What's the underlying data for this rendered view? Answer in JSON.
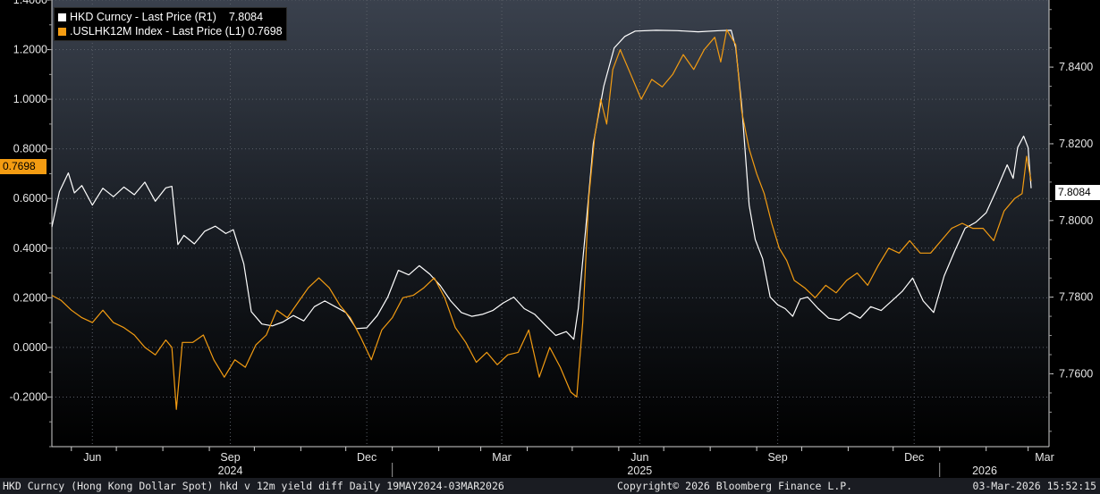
{
  "footer": {
    "left": "HKD Curncy (Hong Kong Dollar Spot) hkd v 12m yield diff Daily 19MAY2024-03MAR2026",
    "center": "Copyright© 2026 Bloomberg Finance L.P.",
    "right": "03-Mar-2026 15:52:15"
  },
  "legend": [
    {
      "label": "HKD Curncy - Last Price (R1)    ",
      "value": "7.8084",
      "color": "#ffffff"
    },
    {
      "label": ".USLHK12M Index - Last Price (L1) ",
      "value": "0.7698",
      "color": "#f39c12"
    }
  ],
  "tags": {
    "left_last": "0.7698",
    "right_last": "7.8084"
  },
  "chart_data": {
    "type": "line",
    "left_axis": {
      "ylim": [
        -0.4,
        1.4
      ],
      "ticks": [
        "1.4000",
        "1.2000",
        "1.0000",
        "0.8000",
        "0.6000",
        "0.4000",
        "0.2000",
        "0.0000",
        "-0.2000"
      ],
      "tick_values": [
        1.4,
        1.2,
        1.0,
        0.8,
        0.6,
        0.4,
        0.2,
        0.0,
        -0.2
      ]
    },
    "right_axis": {
      "ylim": [
        7.741,
        7.8575
      ],
      "ticks": [
        "7.8400",
        "7.8200",
        "7.8000",
        "7.7800",
        "7.7600"
      ],
      "tick_values": [
        7.84,
        7.82,
        7.8,
        7.78,
        7.76
      ]
    },
    "x_axis": {
      "month_labels": [
        "Jun",
        "Sep",
        "Dec",
        "Mar",
        "Jun",
        "Sep",
        "Dec",
        "Mar"
      ],
      "month_label_dates": [
        "2024-06-15",
        "2024-09-15",
        "2024-12-15",
        "2025-03-15",
        "2025-06-15",
        "2025-09-15",
        "2025-12-15",
        "2026-03-15"
      ],
      "year_labels": [
        "2024",
        "2025",
        "2026"
      ],
      "year_label_dates": [
        "2024-09-15",
        "2025-06-15",
        "2026-01-31"
      ],
      "year_separators": [
        "2025-01-01",
        "2026-01-01"
      ],
      "start": "2024-05-19",
      "end": "2026-03-03"
    },
    "grid": true,
    "series": [
      {
        "name": "HKD Curncy - Last Price (R1)",
        "axis": "right",
        "color": "#ffffff",
        "points": [
          [
            "2024-05-19",
            7.7983
          ],
          [
            "2024-05-24",
            7.8075
          ],
          [
            "2024-05-30",
            7.8124
          ],
          [
            "2024-06-03",
            7.8072
          ],
          [
            "2024-06-08",
            7.8091
          ],
          [
            "2024-06-15",
            7.804
          ],
          [
            "2024-06-22",
            7.8084
          ],
          [
            "2024-06-29",
            7.8062
          ],
          [
            "2024-07-06",
            7.8087
          ],
          [
            "2024-07-13",
            7.8067
          ],
          [
            "2024-07-20",
            7.81
          ],
          [
            "2024-07-27",
            7.805
          ],
          [
            "2024-08-03",
            7.8085
          ],
          [
            "2024-08-07",
            7.8089
          ],
          [
            "2024-08-11",
            7.7937
          ],
          [
            "2024-08-15",
            7.7961
          ],
          [
            "2024-08-22",
            7.7939
          ],
          [
            "2024-08-29",
            7.7972
          ],
          [
            "2024-09-05",
            7.7985
          ],
          [
            "2024-09-12",
            7.7966
          ],
          [
            "2024-09-17",
            7.7976
          ],
          [
            "2024-09-24",
            7.7887
          ],
          [
            "2024-09-29",
            7.7762
          ],
          [
            "2024-10-06",
            7.773
          ],
          [
            "2024-10-13",
            7.7725
          ],
          [
            "2024-10-20",
            7.7735
          ],
          [
            "2024-10-27",
            7.7752
          ],
          [
            "2024-11-03",
            7.7738
          ],
          [
            "2024-11-10",
            7.7775
          ],
          [
            "2024-11-17",
            7.779
          ],
          [
            "2024-11-24",
            7.7775
          ],
          [
            "2024-12-01",
            7.776
          ],
          [
            "2024-12-08",
            7.7718
          ],
          [
            "2024-12-15",
            7.772
          ],
          [
            "2024-12-22",
            7.7752
          ],
          [
            "2024-12-29",
            7.78
          ],
          [
            "2025-01-05",
            7.787
          ],
          [
            "2025-01-12",
            7.7858
          ],
          [
            "2025-01-19",
            7.7882
          ],
          [
            "2025-01-26",
            7.786
          ],
          [
            "2025-02-02",
            7.783
          ],
          [
            "2025-02-09",
            7.779
          ],
          [
            "2025-02-16",
            7.776
          ],
          [
            "2025-02-23",
            7.775
          ],
          [
            "2025-03-02",
            7.7755
          ],
          [
            "2025-03-09",
            7.7765
          ],
          [
            "2025-03-16",
            7.7785
          ],
          [
            "2025-03-23",
            7.78
          ],
          [
            "2025-03-30",
            7.777
          ],
          [
            "2025-04-06",
            7.7755
          ],
          [
            "2025-04-13",
            7.7727
          ],
          [
            "2025-04-20",
            7.77
          ],
          [
            "2025-04-27",
            7.771
          ],
          [
            "2025-05-02",
            7.769
          ],
          [
            "2025-05-05",
            7.777
          ],
          [
            "2025-05-10",
            7.798
          ],
          [
            "2025-05-15",
            7.82
          ],
          [
            "2025-05-22",
            7.835
          ],
          [
            "2025-05-29",
            7.845
          ],
          [
            "2025-06-05",
            7.848
          ],
          [
            "2025-06-12",
            7.8494
          ],
          [
            "2025-06-26",
            7.8496
          ],
          [
            "2025-07-10",
            7.8495
          ],
          [
            "2025-07-24",
            7.8492
          ],
          [
            "2025-08-07",
            7.8495
          ],
          [
            "2025-08-15",
            7.8496
          ],
          [
            "2025-08-18",
            7.845
          ],
          [
            "2025-08-22",
            7.83
          ],
          [
            "2025-08-27",
            7.804
          ],
          [
            "2025-08-31",
            7.795
          ],
          [
            "2025-09-05",
            7.79
          ],
          [
            "2025-09-10",
            7.78
          ],
          [
            "2025-09-15",
            7.778
          ],
          [
            "2025-09-20",
            7.777
          ],
          [
            "2025-09-25",
            7.775
          ],
          [
            "2025-09-30",
            7.7795
          ],
          [
            "2025-10-05",
            7.78
          ],
          [
            "2025-10-12",
            7.777
          ],
          [
            "2025-10-19",
            7.7745
          ],
          [
            "2025-10-26",
            7.774
          ],
          [
            "2025-11-02",
            7.776
          ],
          [
            "2025-11-09",
            7.7745
          ],
          [
            "2025-11-16",
            7.7775
          ],
          [
            "2025-11-23",
            7.7765
          ],
          [
            "2025-11-30",
            7.779
          ],
          [
            "2025-12-07",
            7.7815
          ],
          [
            "2025-12-14",
            7.785
          ],
          [
            "2025-12-21",
            7.779
          ],
          [
            "2025-12-28",
            7.776
          ],
          [
            "2026-01-04",
            7.7855
          ],
          [
            "2026-01-11",
            7.792
          ],
          [
            "2026-01-18",
            7.798
          ],
          [
            "2026-01-25",
            7.7995
          ],
          [
            "2026-02-01",
            7.802
          ],
          [
            "2026-02-08",
            7.808
          ],
          [
            "2026-02-15",
            7.8145
          ],
          [
            "2026-02-19",
            7.811
          ],
          [
            "2026-02-22",
            7.819
          ],
          [
            "2026-02-26",
            7.822
          ],
          [
            "2026-03-01",
            7.819
          ],
          [
            "2026-03-03",
            7.8084
          ]
        ]
      },
      {
        "name": ".USLHK12M Index - Last Price (L1)",
        "axis": "left",
        "color": "#f39c12",
        "points": [
          [
            "2024-05-19",
            0.21
          ],
          [
            "2024-05-25",
            0.19
          ],
          [
            "2024-06-01",
            0.15
          ],
          [
            "2024-06-08",
            0.12
          ],
          [
            "2024-06-15",
            0.1
          ],
          [
            "2024-06-22",
            0.15
          ],
          [
            "2024-06-29",
            0.1
          ],
          [
            "2024-07-06",
            0.08
          ],
          [
            "2024-07-13",
            0.05
          ],
          [
            "2024-07-20",
            0.0
          ],
          [
            "2024-07-27",
            -0.03
          ],
          [
            "2024-08-03",
            0.03
          ],
          [
            "2024-08-07",
            0.0
          ],
          [
            "2024-08-10",
            -0.25
          ],
          [
            "2024-08-14",
            0.02
          ],
          [
            "2024-08-21",
            0.02
          ],
          [
            "2024-08-28",
            0.05
          ],
          [
            "2024-09-04",
            -0.05
          ],
          [
            "2024-09-11",
            -0.12
          ],
          [
            "2024-09-18",
            -0.05
          ],
          [
            "2024-09-25",
            -0.08
          ],
          [
            "2024-10-02",
            0.01
          ],
          [
            "2024-10-09",
            0.05
          ],
          [
            "2024-10-16",
            0.15
          ],
          [
            "2024-10-23",
            0.12
          ],
          [
            "2024-10-30",
            0.18
          ],
          [
            "2024-11-06",
            0.24
          ],
          [
            "2024-11-13",
            0.28
          ],
          [
            "2024-11-20",
            0.24
          ],
          [
            "2024-11-27",
            0.17
          ],
          [
            "2024-12-04",
            0.12
          ],
          [
            "2024-12-11",
            0.04
          ],
          [
            "2024-12-18",
            -0.05
          ],
          [
            "2024-12-25",
            0.07
          ],
          [
            "2025-01-01",
            0.12
          ],
          [
            "2025-01-08",
            0.2
          ],
          [
            "2025-01-15",
            0.21
          ],
          [
            "2025-01-22",
            0.24
          ],
          [
            "2025-01-29",
            0.28
          ],
          [
            "2025-02-05",
            0.2
          ],
          [
            "2025-02-12",
            0.08
          ],
          [
            "2025-02-19",
            0.02
          ],
          [
            "2025-02-26",
            -0.06
          ],
          [
            "2025-03-05",
            -0.02
          ],
          [
            "2025-03-12",
            -0.07
          ],
          [
            "2025-03-19",
            -0.03
          ],
          [
            "2025-03-26",
            -0.02
          ],
          [
            "2025-04-02",
            0.07
          ],
          [
            "2025-04-09",
            -0.12
          ],
          [
            "2025-04-16",
            0.0
          ],
          [
            "2025-04-23",
            -0.08
          ],
          [
            "2025-04-30",
            -0.18
          ],
          [
            "2025-05-04",
            -0.2
          ],
          [
            "2025-05-08",
            0.1
          ],
          [
            "2025-05-12",
            0.6
          ],
          [
            "2025-05-16",
            0.85
          ],
          [
            "2025-05-20",
            1.0
          ],
          [
            "2025-05-24",
            0.9
          ],
          [
            "2025-05-28",
            1.12
          ],
          [
            "2025-06-02",
            1.2
          ],
          [
            "2025-06-09",
            1.1
          ],
          [
            "2025-06-16",
            1.0
          ],
          [
            "2025-06-23",
            1.08
          ],
          [
            "2025-06-30",
            1.05
          ],
          [
            "2025-07-07",
            1.1
          ],
          [
            "2025-07-14",
            1.18
          ],
          [
            "2025-07-21",
            1.12
          ],
          [
            "2025-07-28",
            1.2
          ],
          [
            "2025-08-04",
            1.25
          ],
          [
            "2025-08-08",
            1.15
          ],
          [
            "2025-08-12",
            1.28
          ],
          [
            "2025-08-18",
            1.22
          ],
          [
            "2025-08-22",
            0.95
          ],
          [
            "2025-08-27",
            0.8
          ],
          [
            "2025-09-01",
            0.7
          ],
          [
            "2025-09-06",
            0.62
          ],
          [
            "2025-09-11",
            0.5
          ],
          [
            "2025-09-16",
            0.4
          ],
          [
            "2025-09-21",
            0.35
          ],
          [
            "2025-09-26",
            0.27
          ],
          [
            "2025-10-03",
            0.24
          ],
          [
            "2025-10-10",
            0.2
          ],
          [
            "2025-10-17",
            0.25
          ],
          [
            "2025-10-24",
            0.22
          ],
          [
            "2025-10-31",
            0.27
          ],
          [
            "2025-11-07",
            0.3
          ],
          [
            "2025-11-14",
            0.25
          ],
          [
            "2025-11-21",
            0.33
          ],
          [
            "2025-11-28",
            0.4
          ],
          [
            "2025-12-05",
            0.38
          ],
          [
            "2025-12-12",
            0.43
          ],
          [
            "2025-12-19",
            0.38
          ],
          [
            "2025-12-26",
            0.38
          ],
          [
            "2026-01-02",
            0.43
          ],
          [
            "2026-01-09",
            0.48
          ],
          [
            "2026-01-16",
            0.5
          ],
          [
            "2026-01-23",
            0.48
          ],
          [
            "2026-01-30",
            0.48
          ],
          [
            "2026-02-06",
            0.43
          ],
          [
            "2026-02-13",
            0.55
          ],
          [
            "2026-02-20",
            0.6
          ],
          [
            "2026-02-25",
            0.62
          ],
          [
            "2026-02-28",
            0.77
          ],
          [
            "2026-03-03",
            0.67
          ]
        ]
      }
    ]
  }
}
